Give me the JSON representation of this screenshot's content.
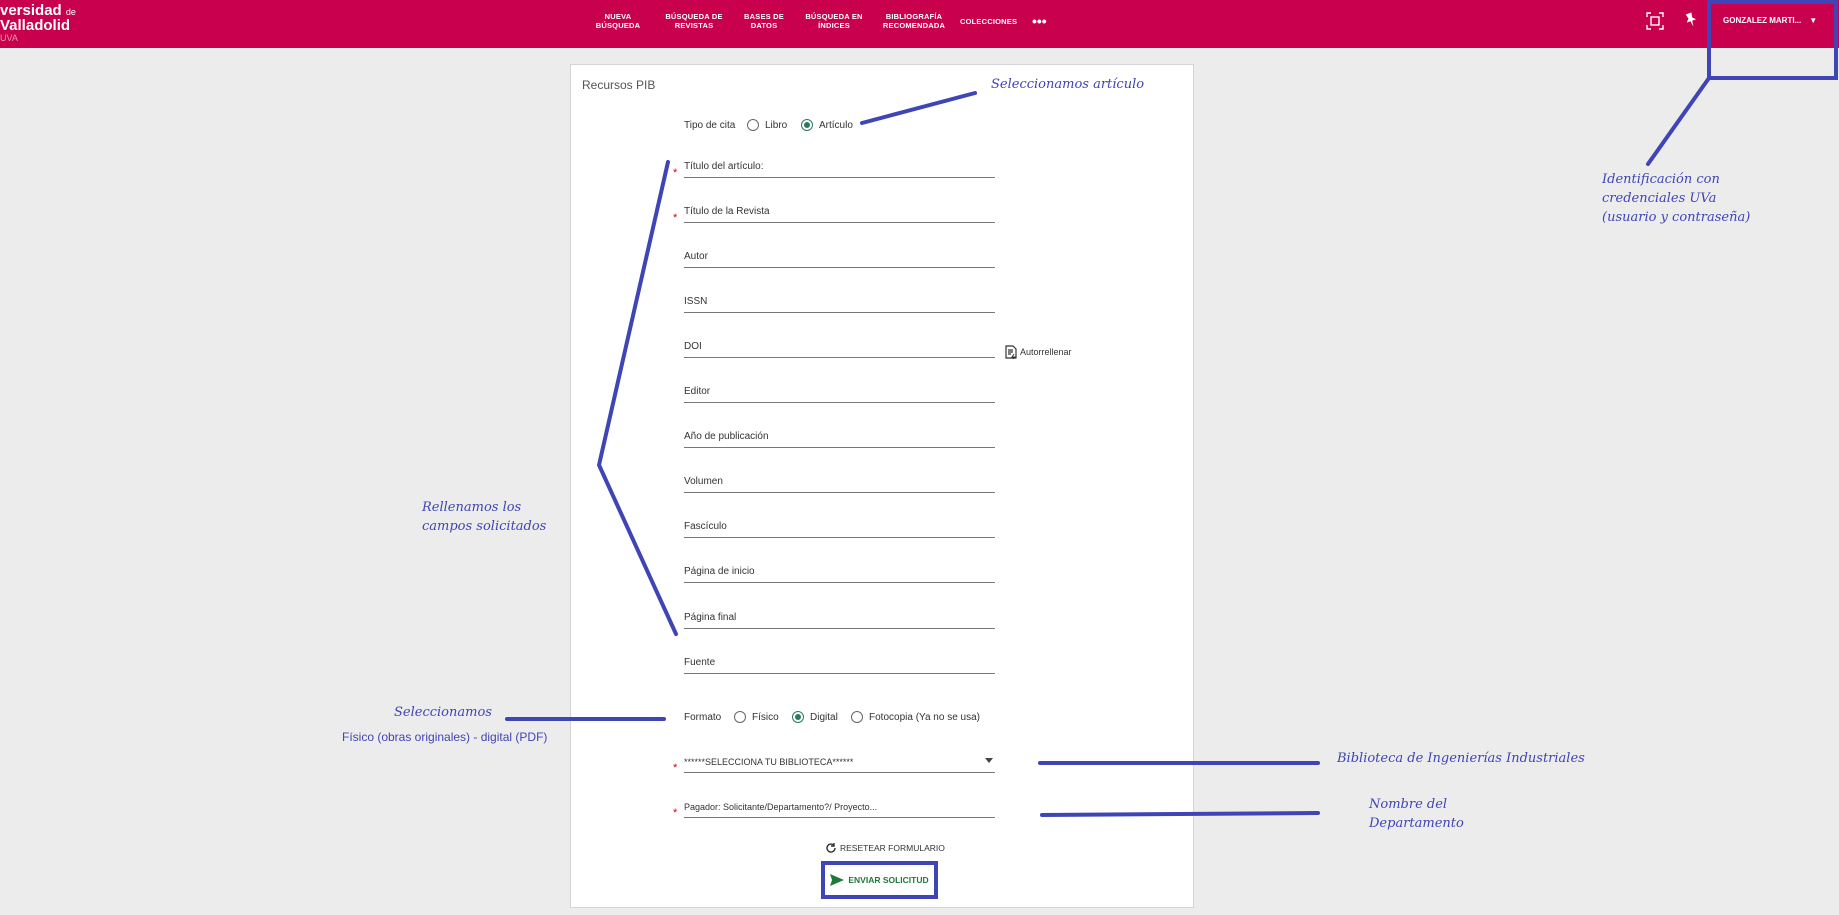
{
  "header": {
    "logo": {
      "line1": "versidad",
      "line1_small": "de",
      "line2": "Valladolid",
      "line3": "UVA"
    },
    "nav": [
      {
        "name": "nav-nueva-busqueda",
        "line1": "NUEVA",
        "line2": "BÚSQUEDA"
      },
      {
        "name": "nav-busqueda-revistas",
        "line1": "BÚSQUEDA DE",
        "line2": "REVISTAS"
      },
      {
        "name": "nav-bases-datos",
        "line1": "BASES DE",
        "line2": "DATOS"
      },
      {
        "name": "nav-busqueda-indices",
        "line1": "BÚSQUEDA EN",
        "line2": "ÍNDICES"
      },
      {
        "name": "nav-bibliografia",
        "line1": "BIBLIOGRAFÍA",
        "line2": "RECOMENDADA"
      },
      {
        "name": "nav-colecciones",
        "line1": "COLECCIONES",
        "line2": ""
      }
    ],
    "more": "•••",
    "user": "GONZALEZ MARTI..."
  },
  "form": {
    "title": "Recursos PIB",
    "tipo": {
      "label": "Tipo de cita",
      "options": [
        "Libro",
        "Artículo"
      ],
      "selected": "Artículo"
    },
    "fields": {
      "titulo_articulo": "Título del artículo:",
      "titulo_revista": "Título de la Revista",
      "autor": "Autor",
      "issn": "ISSN",
      "doi": "DOI",
      "editor": "Editor",
      "anio": "Año de publicación",
      "volumen": "Volumen",
      "fasciculo": "Fascículo",
      "pagina_inicio": "Página de inicio",
      "pagina_final": "Página final",
      "fuente": "Fuente"
    },
    "autofill": "Autorrellenar",
    "formato": {
      "label": "Formato",
      "options": [
        "Físico",
        "Digital",
        "Fotocopia (Ya no se usa)"
      ],
      "selected": "Digital"
    },
    "biblioteca": "******SELECCIONA TU BIBLIOTECA******",
    "pagador": "Pagador: Solicitante/Departamento?/ Proyecto...",
    "reset": "RESETEAR FORMULARIO",
    "send": "ENVIAR SOLICITUD"
  },
  "annotations": {
    "articulo": "Seleccionamos artículo",
    "identificacion": [
      "Identificación con",
      "credenciales UVa",
      "(usuario y contraseña)"
    ],
    "rellenamos": [
      "Rellenamos los",
      "campos solicitados"
    ],
    "seleccionamos": "Seleccionamos",
    "formato_nota": "Físico (obras originales) - digital (PDF)",
    "biblioteca": "Biblioteca de Ingenierías Industriales",
    "departamento": [
      "Nombre del",
      "Departamento"
    ]
  },
  "colors": {
    "brand": "#c8004e",
    "annotation": "#3f45b5",
    "accent": "#2a7a62"
  }
}
